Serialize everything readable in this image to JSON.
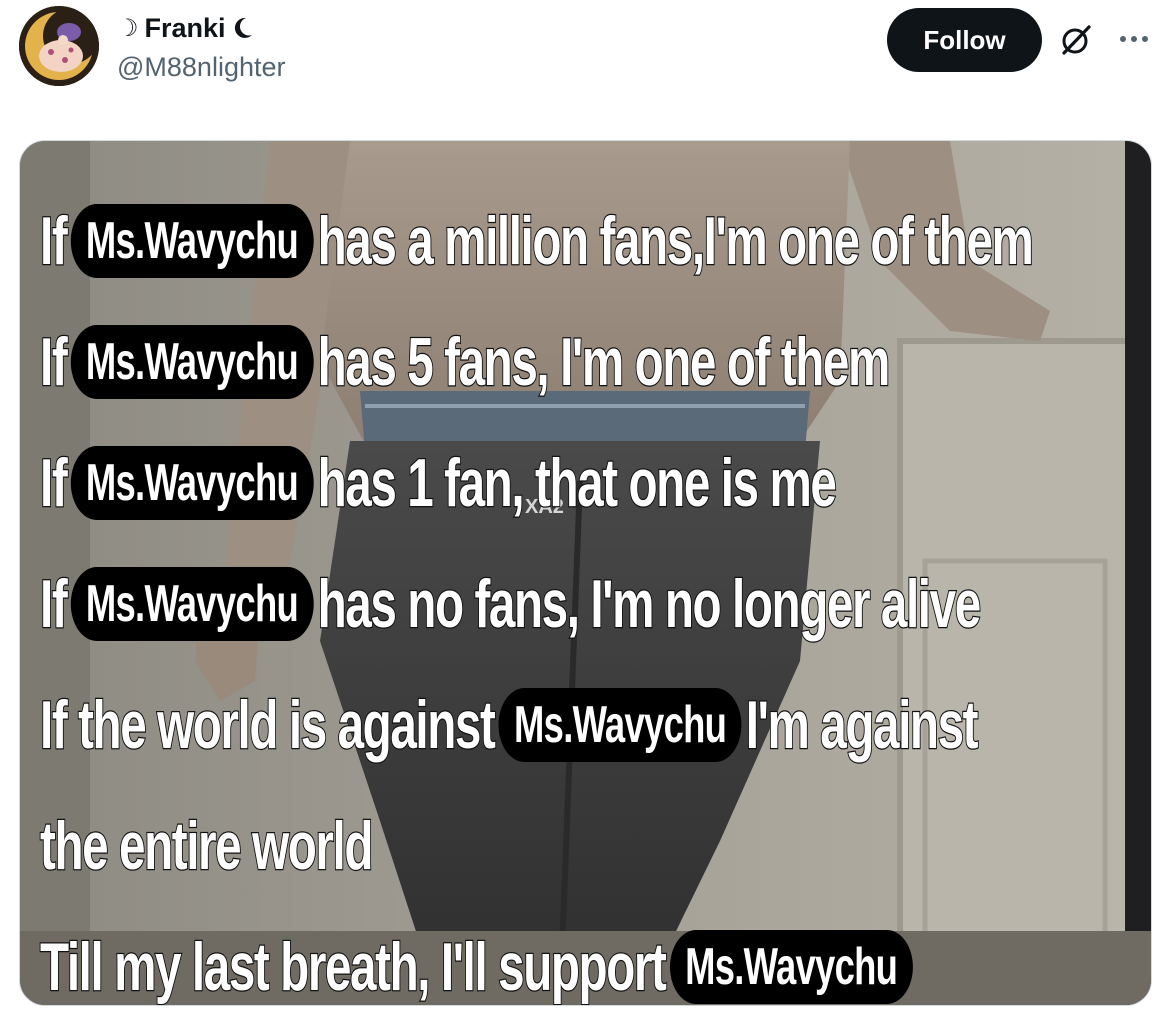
{
  "author": {
    "moon_left": "☽",
    "name": "Franki",
    "handle": "@M88nlighter"
  },
  "actions": {
    "follow_label": "Follow"
  },
  "icons": {
    "avatar": "avatar-image",
    "moon_right": "crescent-moon-icon",
    "grok": "grok-icon",
    "more": "more-icon"
  },
  "meme": {
    "redacted_name": "Ms.Wavychu",
    "line1_prefix": "If",
    "line1_suffix": "has a million fans,I'm one of them",
    "line2_prefix": "If",
    "line2_suffix": "has 5 fans, I'm one of them",
    "line3_prefix": "If",
    "line3_suffix": "has 1 fan, that one is me",
    "line4_prefix": "If",
    "line4_suffix": "has no fans, I'm no longer alive",
    "line5_prefix": "If the world is against",
    "line5_suffix": "I'm against",
    "line6_text": "the entire world",
    "line7_prefix": "Till my last breath, I'll support",
    "underwear_band_text": "XA2"
  },
  "colors": {
    "follow_bg": "#0f1419",
    "handle": "#536471",
    "name": "#0f1419"
  }
}
